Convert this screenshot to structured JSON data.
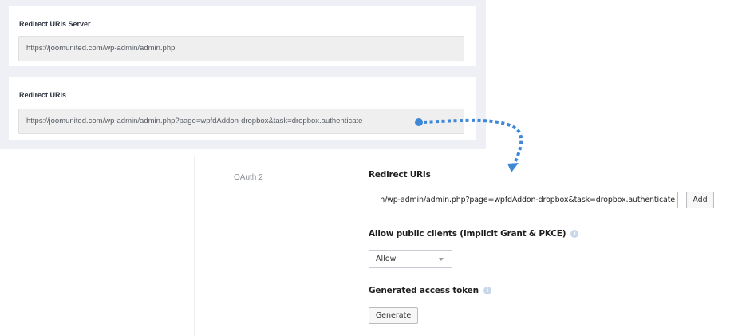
{
  "wp_settings": {
    "server_section": {
      "label": "Redirect URIs Server",
      "value": "https://joomunited.com/wp-admin/admin.php"
    },
    "redirect_section": {
      "label": "Redirect URIs",
      "value": "https://joomunited.com/wp-admin/admin.php?page=wpfdAddon-dropbox&task=dropbox.authenticate"
    }
  },
  "dropbox_console": {
    "section_label": "OAuth 2",
    "redirect_uris": {
      "label": "Redirect URIs",
      "input_value": "n/wp-admin/admin.php?page=wpfdAddon-dropbox&task=dropbox.authenticate",
      "add_button": "Add"
    },
    "public_clients": {
      "label": "Allow public clients (Implicit Grant & PKCE)",
      "selected": "Allow"
    },
    "access_token": {
      "label": "Generated access token",
      "generate_button": "Generate"
    }
  },
  "colors": {
    "arrow": "#3f88d6",
    "panel_bg": "#eef0f5"
  }
}
